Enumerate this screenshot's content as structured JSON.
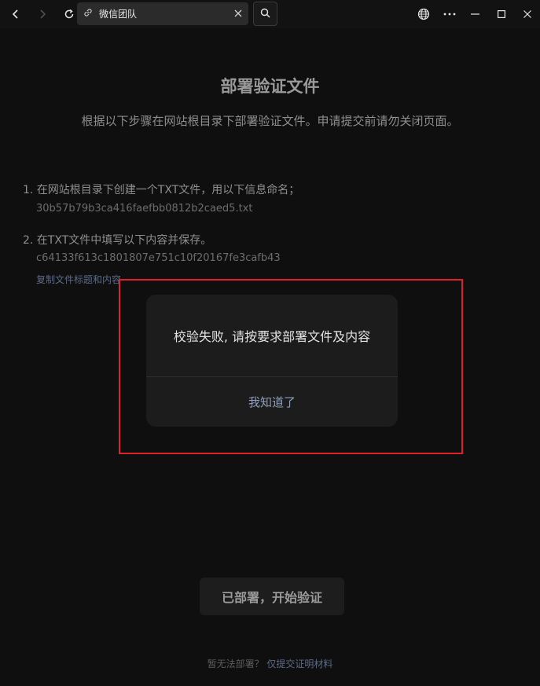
{
  "browser": {
    "tab_title": "微信团队",
    "icons": [
      "back-icon",
      "forward-icon",
      "reload-icon",
      "link-icon",
      "close-icon",
      "search-icon",
      "globe-icon",
      "more-icon",
      "minimize-icon",
      "maximize-icon",
      "window-close-icon"
    ]
  },
  "page": {
    "title": "部署验证文件",
    "subtitle": "根据以下步骤在网站根目录下部署验证文件。申请提交前请勿关闭页面。",
    "steps": [
      {
        "label": "1. 在网站根目录下创建一个TXT文件，用以下信息命名；",
        "value": "30b57b79b3ca416faefbb0812b2caed5.txt"
      },
      {
        "label": "2. 在TXT文件中填写以下内容并保存。",
        "value": "c64133f613c1801807e751c10f20167fe3cafb43"
      }
    ],
    "copy_link": "复制文件标题和内容",
    "deploy_button": "已部署，开始验证",
    "footer_text": "暂无法部署？",
    "footer_link": "仅提交证明材料"
  },
  "dialog": {
    "message": "校验失败, 请按要求部署文件及内容",
    "ok_label": "我知道了"
  },
  "colors": {
    "background": "#0f0f10",
    "dialog_bg": "#1c1c1d",
    "link": "#5b6a86",
    "highlight": "#e0202b"
  }
}
